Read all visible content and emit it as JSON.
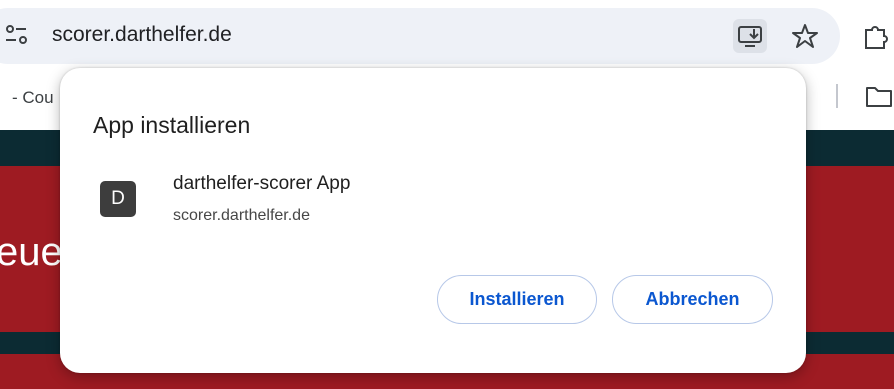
{
  "address_bar": {
    "url": "scorer.darthelfer.de",
    "icons": [
      "site-info-icon",
      "install-app-icon",
      "bookmark-star-icon",
      "extensions-icon"
    ]
  },
  "bookmarks_bar": {
    "partial_item": "- Cou",
    "icons": [
      "bookmarks-folder-icon"
    ]
  },
  "page": {
    "heading_fragment": "eue",
    "colors": {
      "red": "#9e1b22",
      "dark": "#0c2b33"
    }
  },
  "dialog": {
    "title": "App installieren",
    "app": {
      "avatar_letter": "D",
      "name": "darthelfer-scorer App",
      "domain": "scorer.darthelfer.de"
    },
    "buttons": {
      "install": "Installieren",
      "cancel": "Abbrechen"
    },
    "accent_color": "#0b57d0"
  }
}
